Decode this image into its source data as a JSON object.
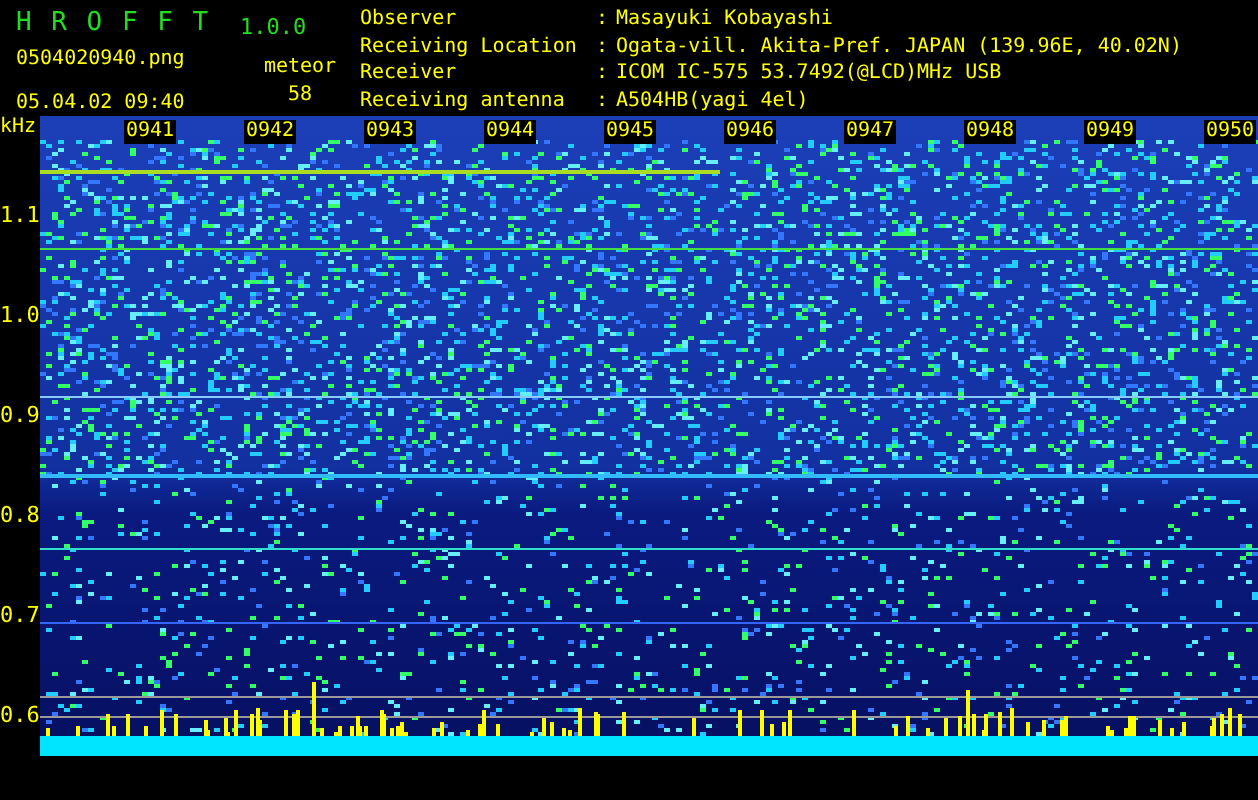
{
  "app": {
    "name": "H R O F F T",
    "version": "1.0.0"
  },
  "file": {
    "name": "0504020940.png",
    "datetime": "05.04.02 09:40"
  },
  "meteor": {
    "label": "meteor",
    "count": "58"
  },
  "info": [
    {
      "label": "Observer",
      "separator": ":",
      "value": "Masayuki Kobayashi"
    },
    {
      "label": "Receiving Location",
      "separator": ":",
      "value": "Ogata-vill. Akita-Pref. JAPAN (139.96E, 40.02N)"
    },
    {
      "label": "Receiver",
      "separator": ":",
      "value": "ICOM IC-575 53.7492(@LCD)MHz USB"
    },
    {
      "label": "Receiving antenna",
      "separator": ":",
      "value": "A504HB(yagi 4el)"
    }
  ],
  "spectrogram": {
    "y_unit": "kHz",
    "y_labels": [
      "1.1",
      "1.0",
      "0.9",
      "0.8",
      "0.7",
      "0.6"
    ],
    "time_labels": [
      "0941",
      "0942",
      "0943",
      "0944",
      "0945",
      "0946",
      "0947",
      "0948",
      "0949",
      "0950"
    ]
  }
}
